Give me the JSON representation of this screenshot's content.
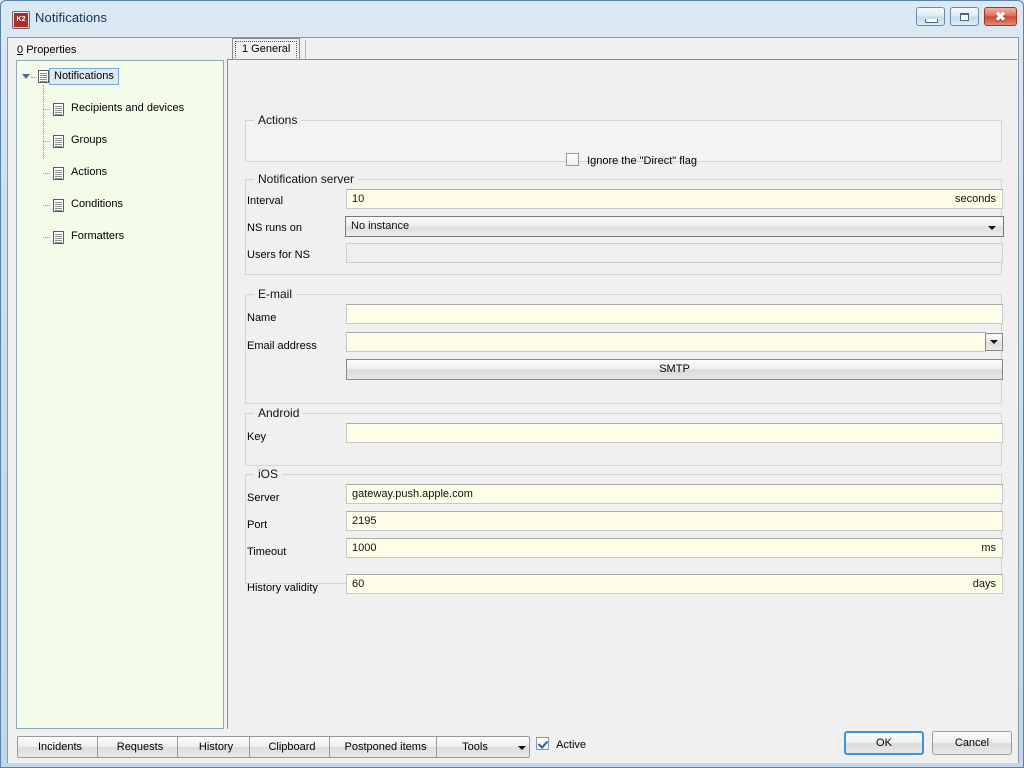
{
  "window": {
    "title": "Notifications",
    "icon": "app-icon",
    "controls": {
      "minimize": "minimize-icon",
      "maximize": "maximize-icon",
      "close": "close-icon"
    }
  },
  "sidebar": {
    "header": "Properties",
    "header_accel": "0",
    "tree": [
      {
        "label": "Notifications",
        "selected": true,
        "level": 0
      },
      {
        "label": "Recipients and devices",
        "selected": false,
        "level": 1
      },
      {
        "label": "Groups",
        "selected": false,
        "level": 1
      },
      {
        "label": "Actions",
        "selected": false,
        "level": 1
      },
      {
        "label": "Conditions",
        "selected": false,
        "level": 1
      },
      {
        "label": "Formatters",
        "selected": false,
        "level": 1
      }
    ]
  },
  "tabs": [
    {
      "label": "1 General",
      "selected": true
    }
  ],
  "groups": {
    "actions": {
      "title": "Actions",
      "ignore_direct": {
        "label": "Ignore the \"Direct\" flag",
        "checked": false
      }
    },
    "notification_server": {
      "title": "Notification server",
      "interval": {
        "label": "Interval",
        "value": "10",
        "suffix": "seconds"
      },
      "ns_runs_on": {
        "label": "NS runs on",
        "value": "No instance"
      },
      "users_for_ns": {
        "label": "Users for NS",
        "value": ""
      }
    },
    "email": {
      "title": "E-mail",
      "name": {
        "label": "Name",
        "value": ""
      },
      "email_address": {
        "label": "Email address",
        "value": ""
      },
      "smtp_button": "SMTP"
    },
    "android": {
      "title": "Android",
      "key": {
        "label": "Key",
        "value": ""
      }
    },
    "ios": {
      "title": "iOS",
      "server": {
        "label": "Server",
        "value": "gateway.push.apple.com"
      },
      "port": {
        "label": "Port",
        "value": "2195"
      },
      "timeout": {
        "label": "Timeout",
        "value": "1000",
        "suffix": "ms"
      }
    },
    "history": {
      "validity": {
        "label": "History validity",
        "value": "60",
        "suffix": "days"
      }
    }
  },
  "toolbar": {
    "buttons": [
      {
        "label": "Incidents"
      },
      {
        "label": "Requests"
      },
      {
        "label": "History"
      },
      {
        "label": "Clipboard"
      },
      {
        "label": "Postponed items"
      },
      {
        "label": "Tools",
        "has_dropdown": true
      }
    ],
    "active": {
      "label": "Active",
      "checked": true
    }
  },
  "dialog_buttons": {
    "ok": "OK",
    "cancel": "Cancel"
  },
  "colors": {
    "field_background": "#FDFDE8",
    "tree_background": "#F3FCE9",
    "panel_background": "#F0F0F0",
    "focus_border": "#3C93D6",
    "selection": "#DCEAF7"
  }
}
